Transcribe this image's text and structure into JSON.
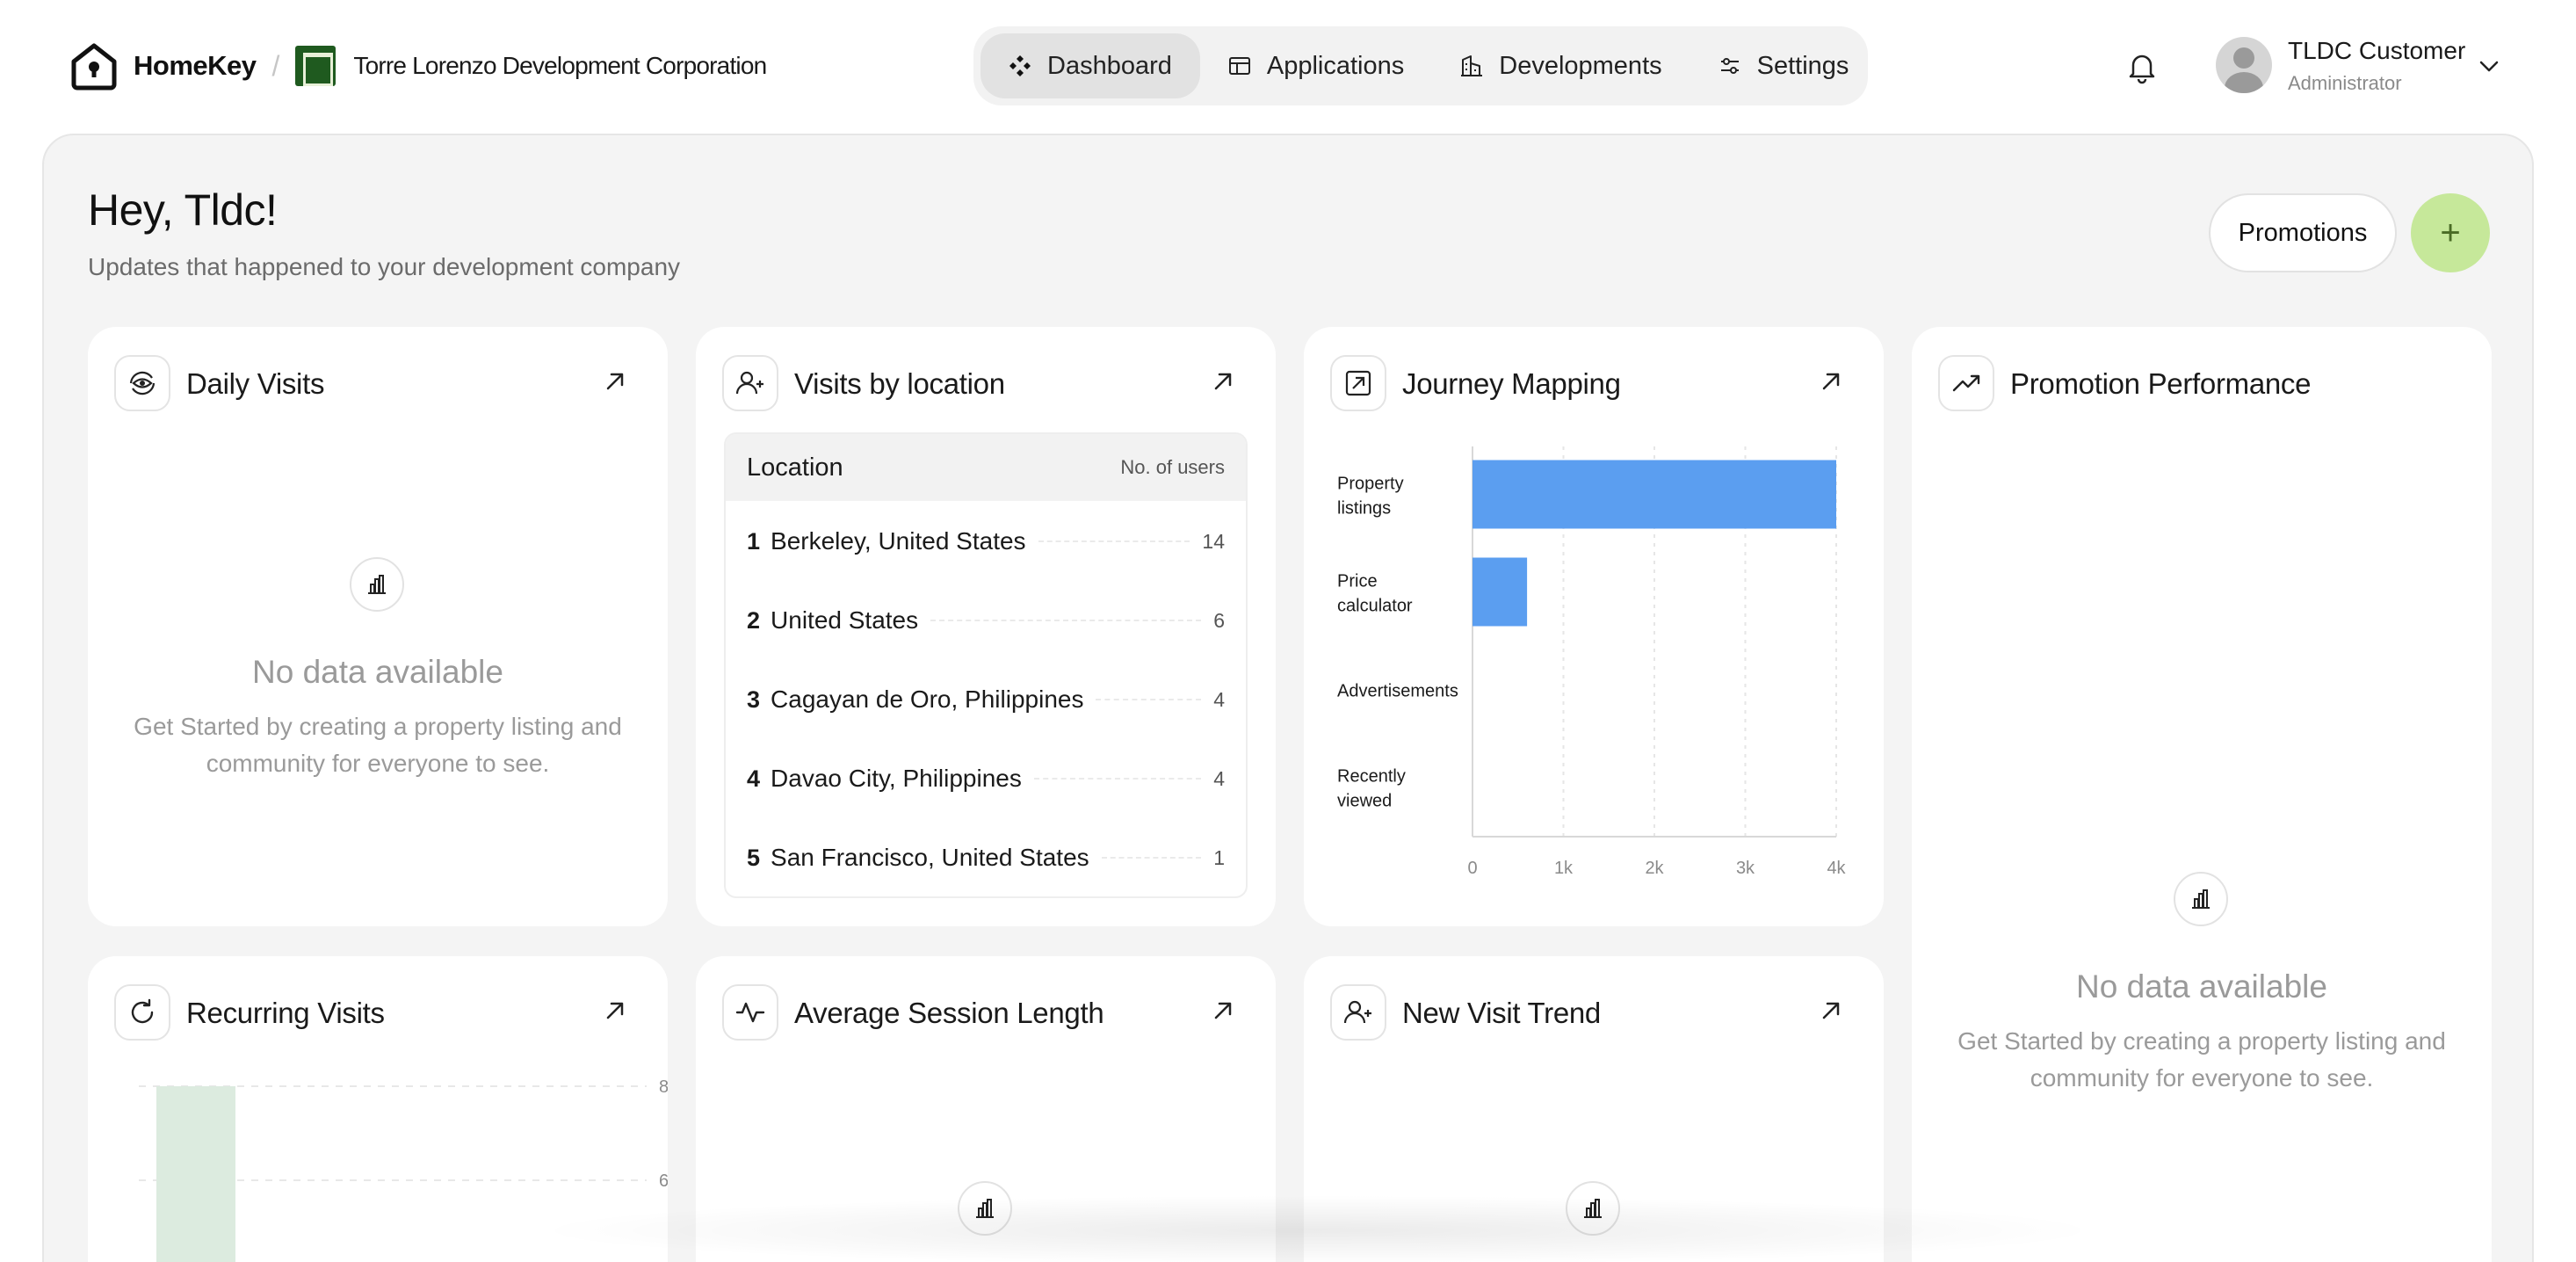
{
  "brand": {
    "name": "HomeKey",
    "separator": "/",
    "org_name": "Torre Lorenzo Development Corporation"
  },
  "nav": {
    "items": [
      {
        "label": "Dashboard",
        "icon": "dashboard-diamond-icon",
        "active": true
      },
      {
        "label": "Applications",
        "icon": "applications-icon",
        "active": false
      },
      {
        "label": "Developments",
        "icon": "buildings-icon",
        "active": false
      },
      {
        "label": "Settings",
        "icon": "sliders-icon",
        "active": false
      }
    ]
  },
  "user": {
    "name": "TLDC Customer",
    "role": "Administrator"
  },
  "header": {
    "greeting": "Hey, Tldc!",
    "subtitle": "Updates that happened to your development company",
    "promotions_label": "Promotions",
    "add_label": "+"
  },
  "empty_state": {
    "title": "No data available",
    "desc": "Get Started by creating a property listing and community for everyone to see."
  },
  "cards": {
    "daily_visits": {
      "title": "Daily Visits"
    },
    "visits_by_location": {
      "title": "Visits by location",
      "col_location": "Location",
      "col_users": "No. of users",
      "rows": [
        {
          "rank": "1",
          "name": "Berkeley, United States",
          "value": "14"
        },
        {
          "rank": "2",
          "name": "United States",
          "value": "6"
        },
        {
          "rank": "3",
          "name": "Cagayan de Oro, Philippines",
          "value": "4"
        },
        {
          "rank": "4",
          "name": "Davao City, Philippines",
          "value": "4"
        },
        {
          "rank": "5",
          "name": "San Francisco, United States",
          "value": "1"
        }
      ]
    },
    "journey_mapping": {
      "title": "Journey Mapping"
    },
    "promotion_performance": {
      "title": "Promotion Performance"
    },
    "recurring_visits": {
      "title": "Recurring Visits"
    },
    "average_session_length": {
      "title": "Average Session Length"
    },
    "new_visit_trend": {
      "title": "New Visit Trend"
    }
  },
  "chart_data": [
    {
      "type": "bar",
      "orientation": "horizontal",
      "categories": [
        "Property listings",
        "Price calculator",
        "Advertisements",
        "Recently viewed"
      ],
      "values": [
        4000,
        600,
        0,
        0
      ],
      "xticks": [
        "0",
        "1k",
        "2k",
        "3k",
        "4k"
      ],
      "xlim": [
        0,
        4000
      ],
      "grid": true,
      "color": "#5b9ef0"
    },
    {
      "type": "bar",
      "categories": [
        ""
      ],
      "values": [
        8
      ],
      "yticks": [
        "8",
        "6"
      ],
      "ylim": [
        0,
        8
      ],
      "y_axis_side": "right",
      "grid": true,
      "color": "#dcebdf"
    }
  ]
}
